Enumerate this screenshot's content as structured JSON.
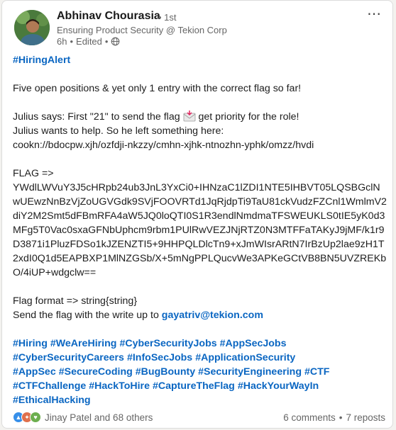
{
  "author": {
    "name": "Abhinav Chourasia",
    "degree": "• 1st",
    "headline": "Ensuring Product Security @ Tekion Corp",
    "time": "6h",
    "edited": "Edited",
    "sep": "•"
  },
  "post": {
    "hiring_tag": "#HiringAlert",
    "line1": "Five open positions & yet only 1 entry with the correct flag so far!",
    "line2a": "Julius says: First \"21\" to send the flag",
    "line2b": "get priority for the role!",
    "line3": "Julius wants to help. So he left something here:",
    "line4": "cookn://bdocpw.xjh/ozfdji-nkzzy/cmhn-xjhk-ntnozhn-yphk/omzz/hvdi",
    "flag_label": "FLAG =>",
    "flag_lines": [
      "YWdlLWVuY3J5cHRpb24ub3JnL3YxCi0+IHNzaC1lZDI1NTE5IHBVT05LQSBGclN",
      "wUEwzNnBzVjZoUGVGdk9SVjFOOVRTd1JqRjdpTi9TaU81ckVudzFZCnl1WmlmV2",
      "diY2M2Smt5dFBmRFA4aW5JQ0loQTI0S1R3endlNmdmaTFSWEUKLS0tIE5yK0d3",
      "MFg5T0Vac0sxaGFNbUphcm9rbm1PUlRwVEZJNjRTZ0N3MTFFaTAKyJ9jMF/k1r9",
      "D3871i1PluzFDSo1kJZENZTI5+9HHPQLDlcTn9+xJmWIsrARtN7IrBzUp2lae9zH1T",
      "2xdI0Q1d5EAPBXP1MlNZGSb/X+5mNgPPLQucvWe3APKeGCtVB8BN5UVZREKb",
      "O/4iUP+wdgclw=="
    ],
    "format_line": "Flag format => string{string}",
    "send_text": "Send the flag with the write up to",
    "email": "gayatriv@tekion.com",
    "hashtag_lines": [
      [
        "#Hiring",
        "#WeAreHiring",
        "#CyberSecurityJobs",
        "#AppSecJobs"
      ],
      [
        "#CyberSecurityCareers",
        "#InfoSecJobs",
        "#ApplicationSecurity"
      ],
      [
        "#AppSec",
        "#SecureCoding",
        "#BugBounty",
        "#SecurityEngineering",
        "#CTF"
      ],
      [
        "#CTFChallenge",
        "#HackToHire",
        "#CaptureTheFlag",
        "#HackYourWayIn"
      ],
      [
        "#EthicalHacking"
      ]
    ]
  },
  "social": {
    "reactors": "Jinay Patel and 68 others",
    "comments": "6 comments",
    "sep": "•",
    "reposts": "7 reposts"
  },
  "icons": [
    "more-options-icon",
    "globe-icon",
    "envelope-icon",
    "like-reaction-icon",
    "celebrate-reaction-icon",
    "support-reaction-icon"
  ],
  "colors": {
    "link": "#0a66c2",
    "text": "#1d1d1d",
    "muted": "#666666"
  }
}
